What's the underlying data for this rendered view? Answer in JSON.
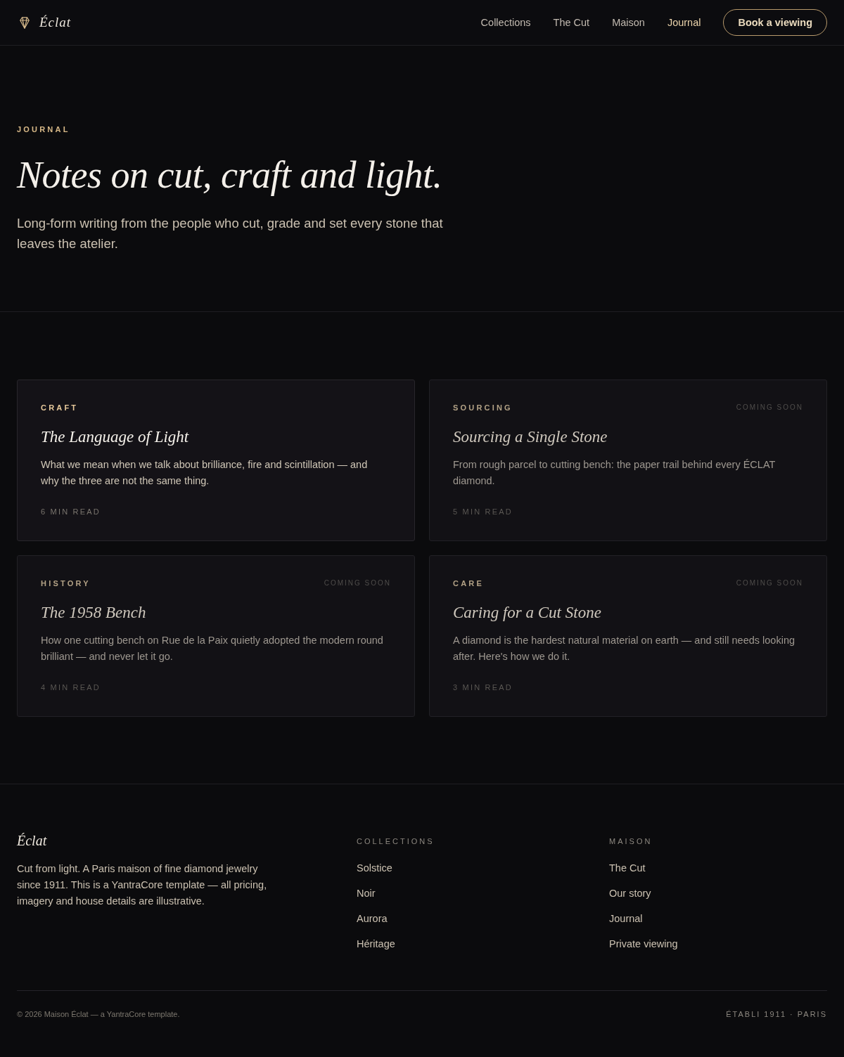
{
  "header": {
    "logo": "Éclat",
    "nav": [
      {
        "label": "Collections",
        "selected": false
      },
      {
        "label": "The Cut",
        "selected": false
      },
      {
        "label": "Maison",
        "selected": false
      },
      {
        "label": "Journal",
        "selected": true
      }
    ],
    "cta": "Book a viewing"
  },
  "hero": {
    "eyebrow": "JOURNAL",
    "title": "Notes on cut, *craft* and light.",
    "lead": "Long-form writing from the people who cut, grade and set every stone that leaves the atelier."
  },
  "articles": [
    {
      "category": "CRAFT",
      "title": "The Language of Light",
      "summary": "What we mean when we talk about brilliance, fire and scintillation — and why the three are not the same thing.",
      "read_time": "6 MIN READ",
      "disabled": false
    },
    {
      "category": "SOURCING",
      "badge": "COMING SOON",
      "title": "Sourcing a Single Stone",
      "summary": "From rough parcel to cutting bench: the paper trail behind every ÉCLAT diamond.",
      "read_time": "5 MIN READ",
      "disabled": true
    },
    {
      "category": "HISTORY",
      "badge": "COMING SOON",
      "title": "The 1958 Bench",
      "summary": "How one cutting bench on Rue de la Paix quietly adopted the modern round brilliant — and never let it go.",
      "read_time": "4 MIN READ",
      "disabled": true
    },
    {
      "category": "CARE",
      "badge": "COMING SOON",
      "title": "Caring for a Cut Stone",
      "summary": "A diamond is the hardest natural material on earth — and still needs looking after. Here's how we do it.",
      "read_time": "3 MIN READ",
      "disabled": true
    }
  ],
  "footer": {
    "brand": "Éclat",
    "blurb": "Cut from light. A Paris maison of fine diamond jewelry since 1911. This is a YantraCore template — all pricing, imagery and house details are illustrative.",
    "columns": [
      {
        "heading": "COLLECTIONS",
        "links": [
          "Solstice",
          "Noir",
          "Aurora",
          "Héritage"
        ]
      },
      {
        "heading": "MAISON",
        "links": [
          "The Cut",
          "Our story",
          "Journal",
          "Private viewing"
        ]
      }
    ],
    "copyright": "© 2026 Maison Éclat — a YantraCore template.",
    "tagline": "ÉTABLI 1911 · PARIS"
  }
}
